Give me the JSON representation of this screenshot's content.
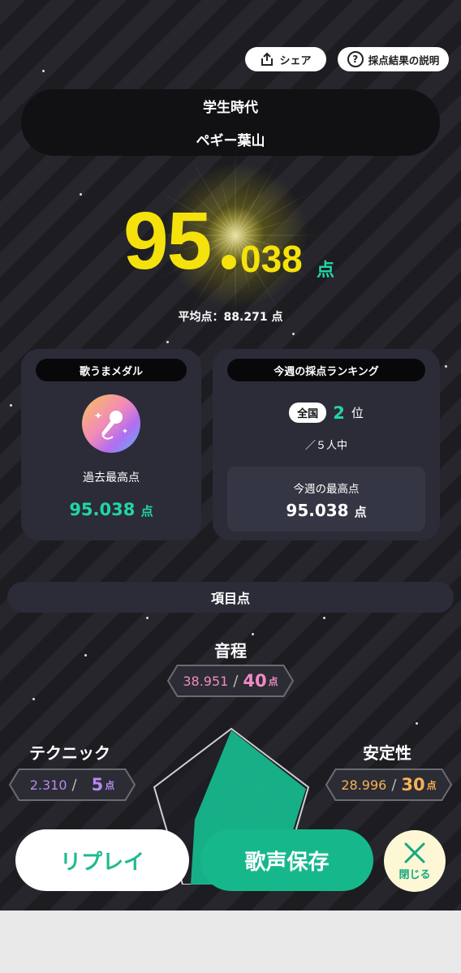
{
  "header": {
    "share_label": "シェア",
    "explain_label": "採点結果の説明"
  },
  "song": {
    "title": "学生時代",
    "artist": "ペギー葉山"
  },
  "score": {
    "integer": "95",
    "decimal": "038",
    "unit": "点",
    "average_line": "平均点：88.271 点"
  },
  "medal": {
    "heading": "歌うまメダル",
    "best_label": "過去最高点",
    "best_score": "95.038",
    "best_unit": "点",
    "icon": "microphone-medal-icon"
  },
  "ranking": {
    "heading": "今週の採点ランキング",
    "region": "全国",
    "rank": "2",
    "rank_unit": "位",
    "total": "／５人中",
    "week_best_label": "今週の最高点",
    "week_best_score": "95.038",
    "week_best_unit": "点"
  },
  "items": {
    "heading": "項目点",
    "pitch": {
      "label": "音程",
      "value": "38.951",
      "slash": "/",
      "max": "40",
      "unit": "点"
    },
    "technique": {
      "label": "テクニック",
      "value": "2.310",
      "slash": "/",
      "max": "5",
      "unit": "点"
    },
    "stability": {
      "label": "安定性",
      "value": "28.996",
      "slash": "/",
      "max": "30",
      "unit": "点"
    }
  },
  "colors": {
    "accent_green": "#17b78c",
    "score_yellow": "#f5e20c",
    "pitch_pink": "#f08bc4",
    "technique_purple": "#b689f2",
    "stability_orange": "#f6b256"
  },
  "footer": {
    "replay_label": "リプレイ",
    "save_label": "歌声保存",
    "close_label": "閉じる"
  }
}
